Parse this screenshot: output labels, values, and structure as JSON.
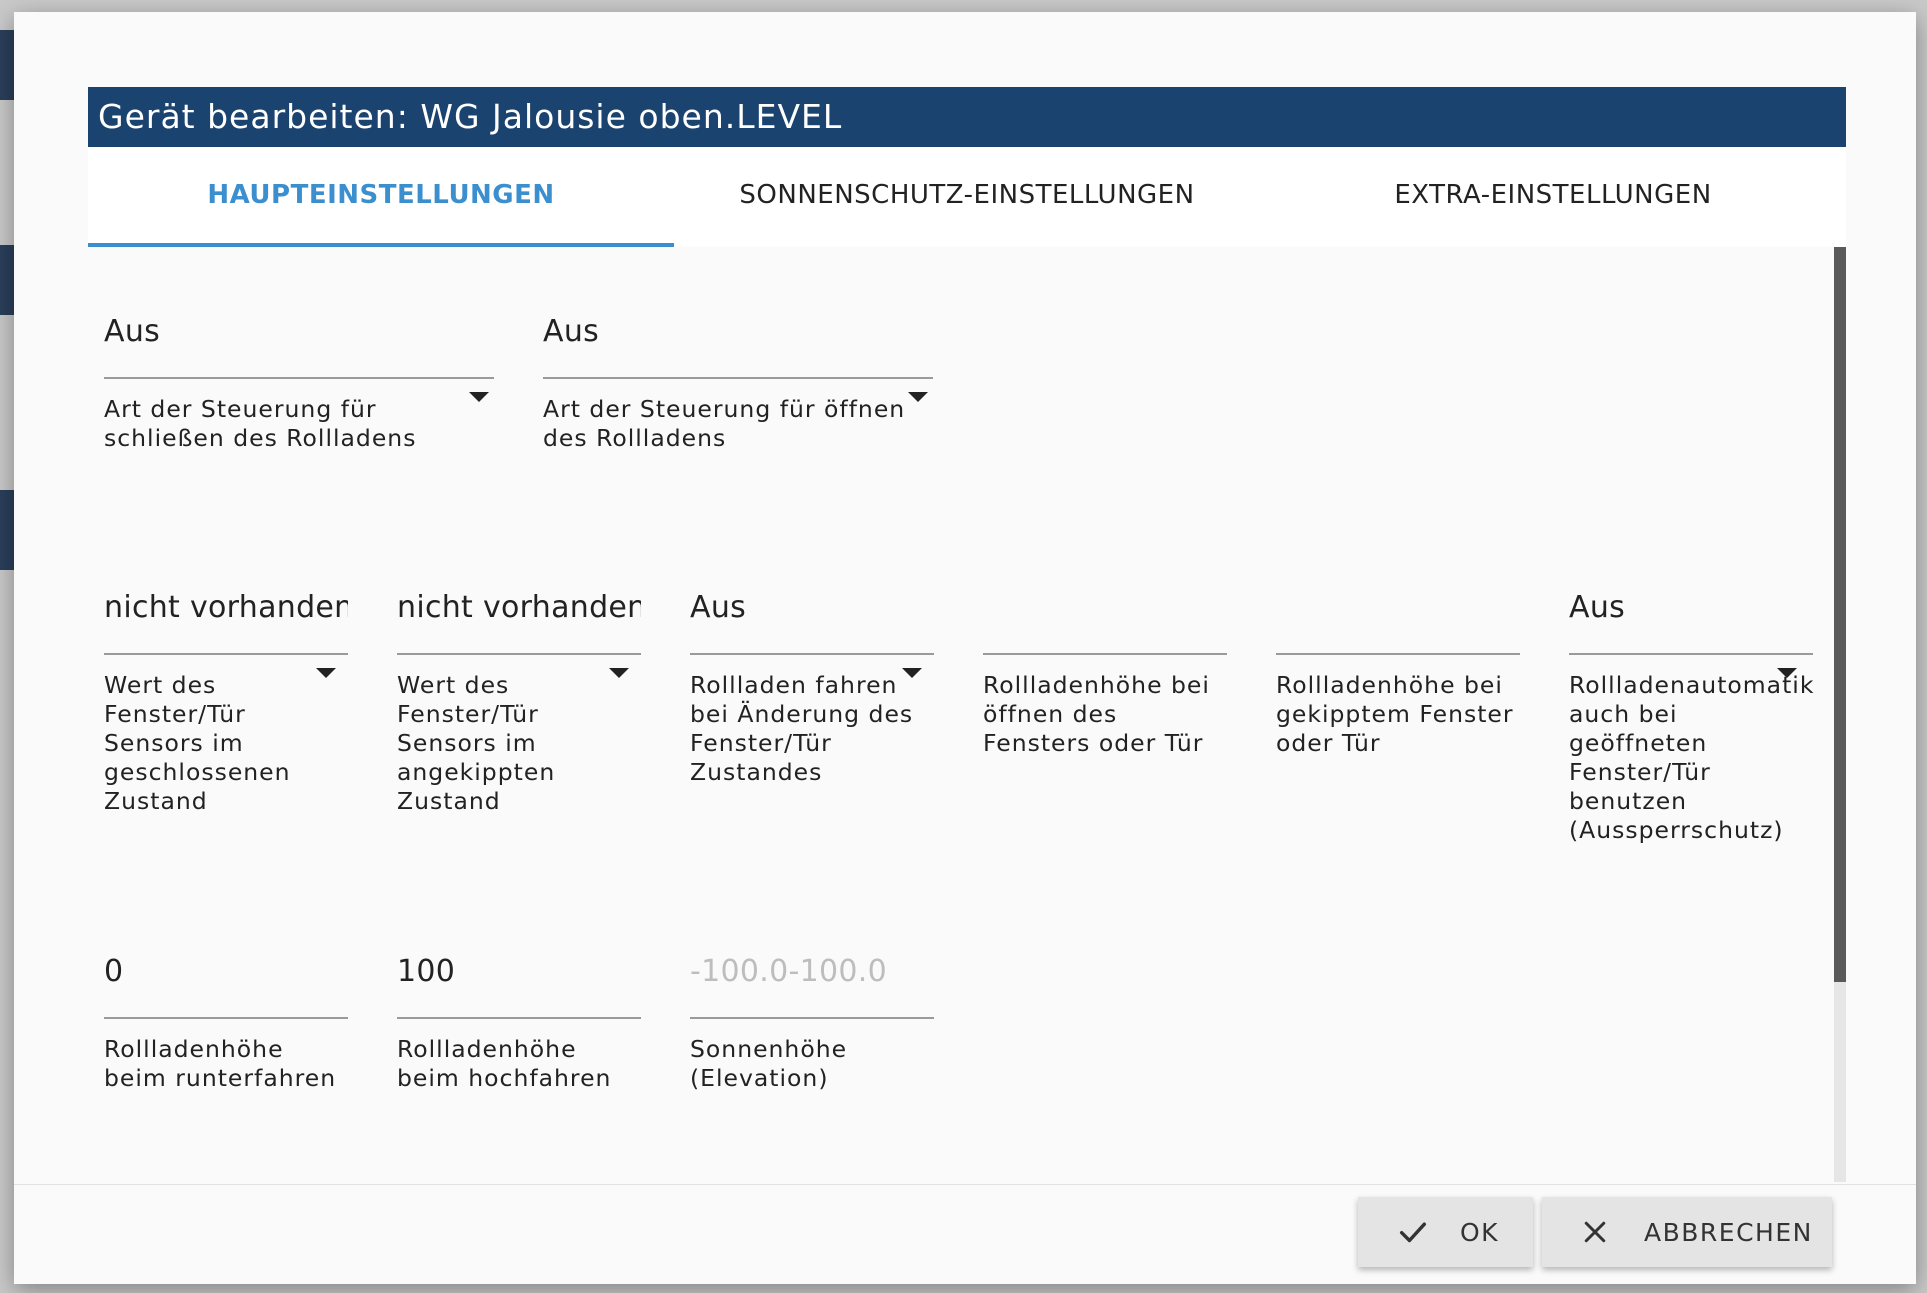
{
  "dialog": {
    "title": "Gerät bearbeiten: WG Jalousie oben.LEVEL"
  },
  "tabs": [
    {
      "label": "HAUPTEINSTELLUNGEN",
      "active": true
    },
    {
      "label": "SONNENSCHUTZ-EINSTELLUNGEN",
      "active": false
    },
    {
      "label": "EXTRA-EINSTELLUNGEN",
      "active": false
    }
  ],
  "row1": [
    {
      "value": "Aus",
      "label": "Art der Steuerung für schließen des Rollladens",
      "type": "select"
    },
    {
      "value": "Aus",
      "label": "Art der Steuerung für öffnen des Rollladens",
      "type": "select"
    }
  ],
  "row2": [
    {
      "value": "nicht vorhanden",
      "label": "Wert des Fenster/Tür Sensors im geschlossenen Zustand",
      "type": "select"
    },
    {
      "value": "nicht vorhanden",
      "label": "Wert des Fenster/Tür Sensors im angekippten Zustand",
      "type": "select"
    },
    {
      "value": "Aus",
      "label": "Rollladen fahren bei Änderung des Fenster/Tür Zustandes",
      "type": "select"
    },
    {
      "value": "",
      "label": "Rollladenhöhe bei öffnen des Fensters oder Tür",
      "type": "input"
    },
    {
      "value": "",
      "label": "Rollladenhöhe bei gekipptem Fenster oder Tür",
      "type": "input"
    },
    {
      "value": "Aus",
      "label": "Rollladenautomatik auch bei geöffneten Fenster/Tür benutzen (Aussperrschutz)",
      "type": "select"
    }
  ],
  "row3": [
    {
      "value": "0",
      "label": "Rollladenhöhe beim runterfahren",
      "type": "input"
    },
    {
      "value": "100",
      "label": "Rollladenhöhe beim hochfahren",
      "type": "input"
    },
    {
      "value": "",
      "placeholder": "-100.0-100.0",
      "label": "Sonnenhöhe (Elevation)",
      "type": "input"
    }
  ],
  "buttons": {
    "ok": {
      "label": "OK",
      "icon": "check-icon"
    },
    "cancel": {
      "label": "ABBRECHEN",
      "icon": "close-icon"
    }
  },
  "colors": {
    "title_bar": "#1b4370",
    "tab_active": "#3b8fcf"
  }
}
